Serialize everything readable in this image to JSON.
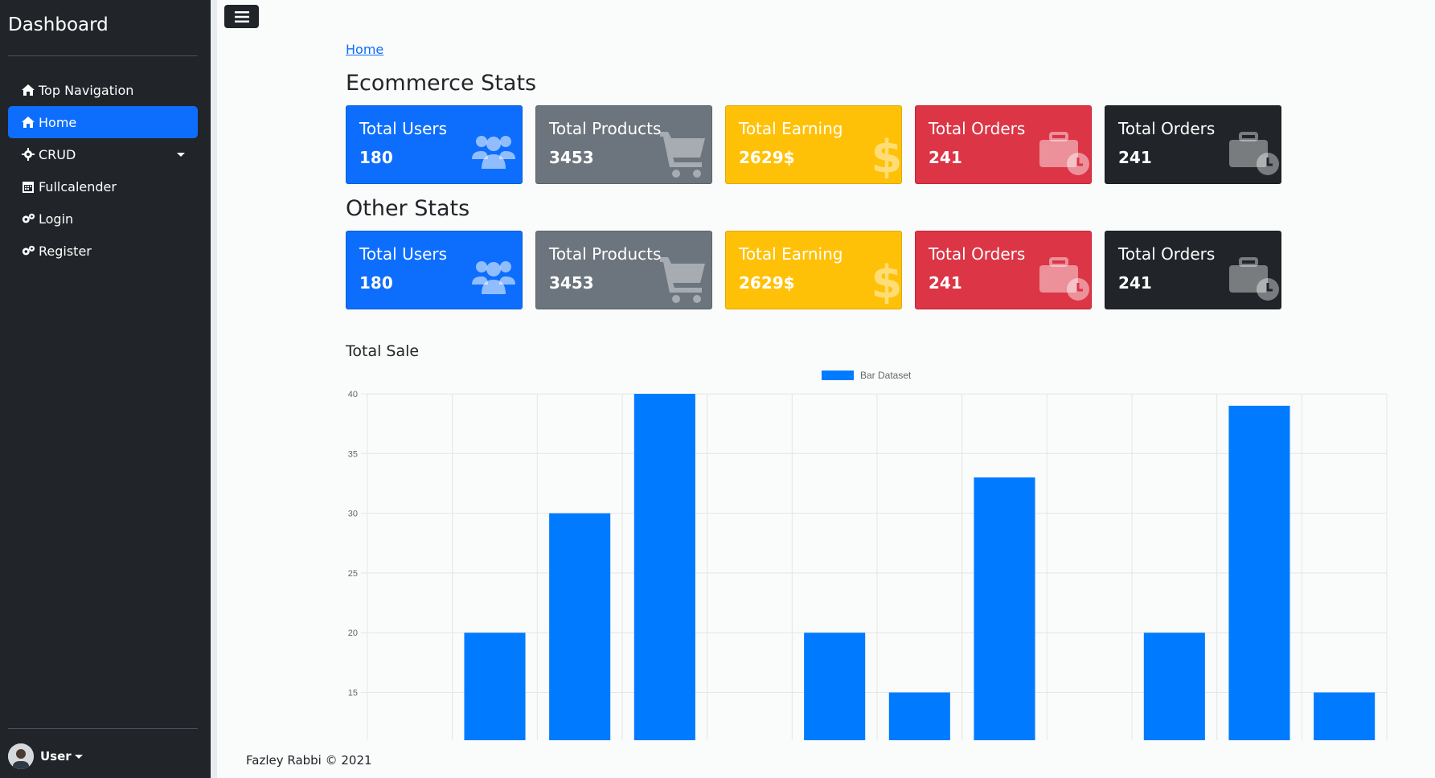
{
  "sidebar": {
    "title": "Dashboard",
    "items": [
      {
        "label": "Top Navigation",
        "icon": "home-icon"
      },
      {
        "label": "Home",
        "icon": "home-icon",
        "active": true
      },
      {
        "label": "CRUD",
        "icon": "gear-icon",
        "dropdown": true
      },
      {
        "label": "Fullcalender",
        "icon": "calendar-icon"
      },
      {
        "label": "Login",
        "icon": "gears-icon"
      },
      {
        "label": "Register",
        "icon": "gears-icon"
      }
    ],
    "user": "User"
  },
  "breadcrumb": "Home",
  "sections": [
    {
      "title": "Ecommerce Stats",
      "cards": [
        {
          "label": "Total Users",
          "value": "180",
          "icon": "users-icon",
          "color": "#0d6efd"
        },
        {
          "label": "Total Products",
          "value": "3453",
          "icon": "cart-icon",
          "color": "#6c757d"
        },
        {
          "label": "Total Earning",
          "value": "2629$",
          "icon": "dollar-icon",
          "color": "#ffc107"
        },
        {
          "label": "Total Orders",
          "value": "241",
          "icon": "briefcase-clock-icon",
          "color": "#dc3545"
        },
        {
          "label": "Total Orders",
          "value": "241",
          "icon": "briefcase-clock-icon",
          "color": "#212529"
        }
      ]
    },
    {
      "title": "Other Stats",
      "cards": [
        {
          "label": "Total Users",
          "value": "180",
          "icon": "users-icon",
          "color": "#0d6efd"
        },
        {
          "label": "Total Products",
          "value": "3453",
          "icon": "cart-icon",
          "color": "#6c757d"
        },
        {
          "label": "Total Earning",
          "value": "2629$",
          "icon": "dollar-icon",
          "color": "#ffc107"
        },
        {
          "label": "Total Orders",
          "value": "241",
          "icon": "briefcase-clock-icon",
          "color": "#dc3545"
        },
        {
          "label": "Total Orders",
          "value": "241",
          "icon": "briefcase-clock-icon",
          "color": "#212529"
        }
      ]
    }
  ],
  "chart_title": "Total Sale",
  "chart_data": {
    "type": "bar",
    "categories": [
      "",
      "",
      "",
      "",
      "",
      "",
      "",
      "",
      "",
      "",
      "",
      ""
    ],
    "series": [
      {
        "name": "Bar Dataset",
        "color": "#007bff",
        "values": [
          10,
          20,
          30,
          40,
          10,
          20,
          15,
          33,
          10,
          20,
          39,
          15
        ]
      }
    ],
    "yticks": [
      15,
      20,
      25,
      30,
      35,
      40
    ],
    "ylim": [
      11,
      40
    ],
    "legend": "top-center",
    "grid": true
  },
  "footer": "Fazley Rabbi © 2021"
}
